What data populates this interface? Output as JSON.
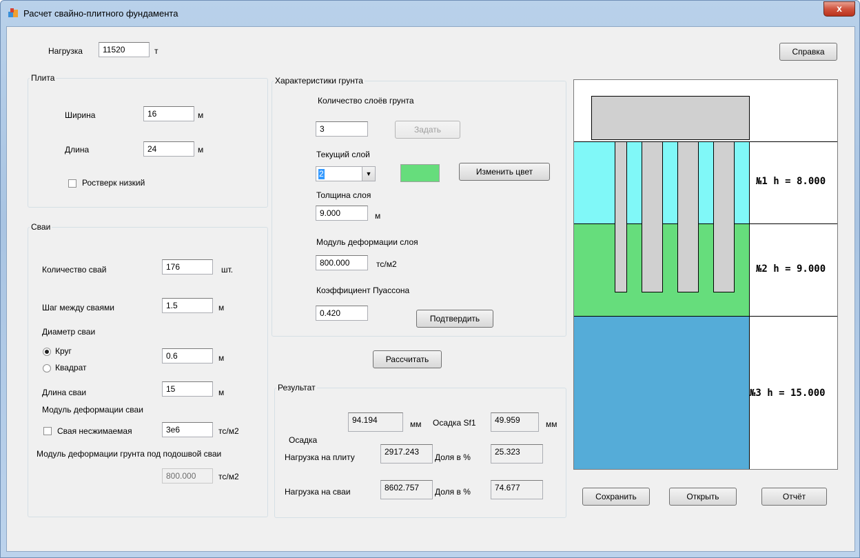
{
  "window": {
    "title": "Расчет свайно-плитного фундамента",
    "close_label": "x"
  },
  "load": {
    "label": "Нагрузка",
    "value": "11520",
    "unit": "т"
  },
  "help_button": "Справка",
  "plate": {
    "legend": "Плита",
    "width_label": "Ширина",
    "width_value": "16",
    "width_unit": "м",
    "length_label": "Длина",
    "length_value": "24",
    "length_unit": "м",
    "low_grillage_label": "Ростверк низкий",
    "low_grillage_checked": false
  },
  "piles": {
    "legend": "Сваи",
    "count_label": "Количество свай",
    "count_value": "176",
    "count_unit": "шт.",
    "step_label": "Шаг между сваями",
    "step_value": "1.5",
    "step_unit": "м",
    "diameter_label": "Диаметр сваи",
    "shape_circle": "Круг",
    "shape_square": "Квадрат",
    "shape_selected": "circle",
    "diameter_value": "0.6",
    "diameter_unit": "м",
    "length_label": "Длина сваи",
    "length_value": "15",
    "length_unit": "м",
    "modulus_label": "Модуль деформации сваи",
    "incompressible_label": "Свая несжимаемая",
    "incompressible_checked": false,
    "modulus_value": "3e6",
    "modulus_unit": "тс/м2",
    "soil_under_label": "Модуль деформации грунта под подошвой сваи",
    "soil_under_value": "800.000",
    "soil_under_unit": "тс/м2"
  },
  "soil": {
    "legend": "Характеристики грунта",
    "layers_count_label": "Количество слоёв грунта",
    "layers_count_value": "3",
    "set_button": "Задать",
    "current_layer_label": "Текущий слой",
    "current_layer_value": "2",
    "change_color_button": "Изменить цвет",
    "current_color": "#66dd7c",
    "thickness_label": "Толщина слоя",
    "thickness_value": "9.000",
    "thickness_unit": "м",
    "modulus_label": "Модуль деформации слоя",
    "modulus_value": "800.000",
    "modulus_unit": "тс/м2",
    "poisson_label": "Коэффициент Пуассона",
    "poisson_value": "0.420",
    "confirm_button": "Подтвердить"
  },
  "calculate_button": "Рассчитать",
  "result": {
    "legend": "Результат",
    "settlement_label": "Осадка",
    "settlement_value": "94.194",
    "settlement_unit": "мм",
    "settlement_sf1_label": "Осадка Sf1",
    "settlement_sf1_value": "49.959",
    "settlement_sf1_unit": "мм",
    "plate_load_label": "Нагрузка на плиту",
    "plate_load_value": "2917.243",
    "plate_share_label": "Доля в %",
    "plate_share_value": "25.323",
    "piles_load_label": "Нагрузка на сваи",
    "piles_load_value": "8602.757",
    "piles_share_label": "Доля в %",
    "piles_share_value": "74.677"
  },
  "diagram": {
    "layers": [
      {
        "label": "№1  h = 8.000",
        "color": "#80f8f8"
      },
      {
        "label": "№2  h = 9.000",
        "color": "#66dd7c"
      },
      {
        "label": "№3  h = 15.000",
        "color": "#55acd8"
      }
    ],
    "plate_color": "#d0d0d0",
    "pile_color": "#d0d0d0"
  },
  "bottom_buttons": {
    "save": "Сохранить",
    "open": "Открыть",
    "report": "Отчёт"
  }
}
